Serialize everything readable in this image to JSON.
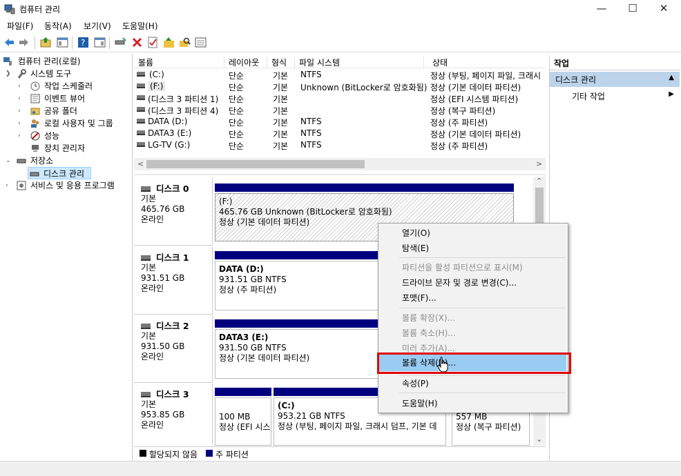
{
  "window": {
    "title": "컴퓨터 관리",
    "minimize": "—",
    "maximize": "☐",
    "close": "✕"
  },
  "menu": [
    "파일(F)",
    "동작(A)",
    "보기(V)",
    "도움말(H)"
  ],
  "tree": {
    "root": "컴퓨터 관리(로컬)",
    "system_tools": "시스템 도구",
    "task_scheduler": "작업 스케줄러",
    "event_viewer": "이벤트 뷰어",
    "shared_folders": "공유 폴더",
    "local_users": "로컬 사용자 및 그룹",
    "performance": "성능",
    "device_manager": "장치 관리자",
    "storage": "저장소",
    "disk_management": "디스크 관리",
    "services": "서비스 및 응용 프로그램"
  },
  "list": {
    "headers": [
      "볼륨",
      "레이아웃",
      "형식",
      "파일 시스템",
      "상태"
    ],
    "rows": [
      [
        "(C:)",
        "단순",
        "기본",
        "NTFS",
        "정상 (부팅, 페이지 파일, 크래시"
      ],
      [
        "(F:)",
        "단순",
        "기본",
        "Unknown (BitLocker로 암호화됨)",
        "정상 (기본 데이터 파티션)"
      ],
      [
        "(디스크 3 파티션 1)",
        "단순",
        "기본",
        "",
        "정상 (EFI 시스템 파티션)"
      ],
      [
        "(디스크 3 파티션 4)",
        "단순",
        "기본",
        "",
        "정상 (복구 파티션)"
      ],
      [
        "DATA (D:)",
        "단순",
        "기본",
        "NTFS",
        "정상 (주 파티션)"
      ],
      [
        "DATA3 (E:)",
        "단순",
        "기본",
        "NTFS",
        "정상 (기본 데이터 파티션)"
      ],
      [
        "LG-TV (G:)",
        "단순",
        "기본",
        "NTFS",
        "정상 (주 파티션)"
      ]
    ]
  },
  "disks": [
    {
      "name": "디스크 0",
      "type": "기본",
      "size": "465.76 GB",
      "state": "온라인",
      "partition": {
        "title": "(F:)",
        "line1": "465.76 GB Unknown (BitLocker로 암호화됨)",
        "line2": "정상 (기본 데이터 파티션)"
      }
    },
    {
      "name": "디스크 1",
      "type": "기본",
      "size": "931.51 GB",
      "state": "온라인",
      "partition": {
        "title": "DATA  (D:)",
        "line1": "931.51 GB NTFS",
        "line2": "정상 (주 파티션)"
      }
    },
    {
      "name": "디스크 2",
      "type": "기본",
      "size": "931.50 GB",
      "state": "온라인",
      "partition": {
        "title": "DATA3  (E:)",
        "line1": "931.50 GB NTFS",
        "line2": "정상 (기본 데이터 파티션)"
      }
    },
    {
      "name": "디스크 3",
      "type": "기본",
      "size": "953.85 GB",
      "state": "온라인",
      "p1": {
        "line1": "100 MB",
        "line2": "정상 (EFI 시스"
      },
      "p2": {
        "title": "(C:)",
        "line1": "953.21 GB NTFS",
        "line2": "정상 (부팅, 페이지 파일, 크래시 덤프, 기본 데"
      },
      "p3": {
        "line1": "557 MB",
        "line2": "정상 (복구 파티션)"
      }
    }
  ],
  "legend": {
    "unallocated": "할당되지 않음",
    "primary": "주 파티션"
  },
  "actions": {
    "header": "작업",
    "section": "디스크 관리",
    "more": "기타 작업"
  },
  "context_menu": {
    "open": "열기(O)",
    "explore": "탐색(E)",
    "mark_active": "파티션을 활성 파티션으로 표시(M)",
    "change_letter": "드라이브 문자 및 경로 변경(C)...",
    "format": "포맷(F)...",
    "extend": "볼륨 확장(X)...",
    "shrink": "볼륨 축소(H)...",
    "mirror": "미러 추가(A)...",
    "delete": "볼륨 삭제(D)...",
    "properties": "속성(P)",
    "help": "도움말(H)"
  },
  "colors": {
    "primary_bar": "#00007f",
    "selection": "#99ccf3",
    "highlight_box": "#e00000",
    "action_section": "#bcd3ea"
  }
}
